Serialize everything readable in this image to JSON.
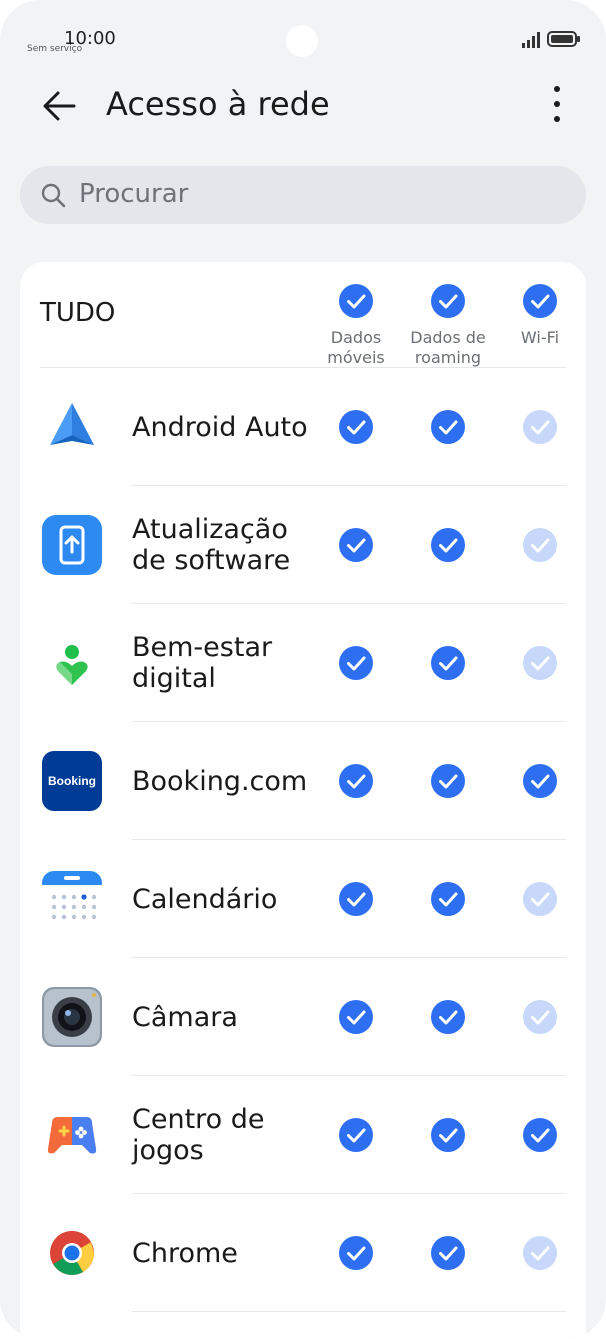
{
  "status": {
    "time": "10:00",
    "carrier": "Sem serviço"
  },
  "header": {
    "title": "Acesso à rede"
  },
  "search": {
    "placeholder": "Procurar"
  },
  "all": {
    "label": "TUDO",
    "columns": [
      {
        "line1": "Dados",
        "line2": "móveis",
        "checked": true
      },
      {
        "line1": "Dados de",
        "line2": "roaming",
        "checked": true
      },
      {
        "line1": "Wi-Fi",
        "line2": "",
        "checked": true
      }
    ]
  },
  "apps": [
    {
      "name": "Android Auto",
      "icon": "android-auto-icon",
      "mobile": "on",
      "roaming": "on",
      "wifi": "disabled"
    },
    {
      "name": "Atualização\nde software",
      "icon": "software-update-icon",
      "mobile": "on",
      "roaming": "on",
      "wifi": "disabled"
    },
    {
      "name": "Bem-estar\ndigital",
      "icon": "digital-wellbeing-icon",
      "mobile": "on",
      "roaming": "on",
      "wifi": "disabled"
    },
    {
      "name": "Booking.com",
      "icon": "booking-icon",
      "icon_text": "Booking",
      "mobile": "on",
      "roaming": "on",
      "wifi": "on"
    },
    {
      "name": "Calendário",
      "icon": "calendar-icon",
      "mobile": "on",
      "roaming": "on",
      "wifi": "disabled"
    },
    {
      "name": "Câmara",
      "icon": "camera-icon",
      "mobile": "on",
      "roaming": "on",
      "wifi": "disabled"
    },
    {
      "name": "Centro de\njogos",
      "icon": "game-center-icon",
      "mobile": "on",
      "roaming": "on",
      "wifi": "on"
    },
    {
      "name": "Chrome",
      "icon": "chrome-icon",
      "mobile": "on",
      "roaming": "on",
      "wifi": "disabled"
    }
  ],
  "colors": {
    "check_on": "#2e6ff2",
    "check_disabled": "#c7d8fb",
    "background": "#f1f3f5"
  }
}
